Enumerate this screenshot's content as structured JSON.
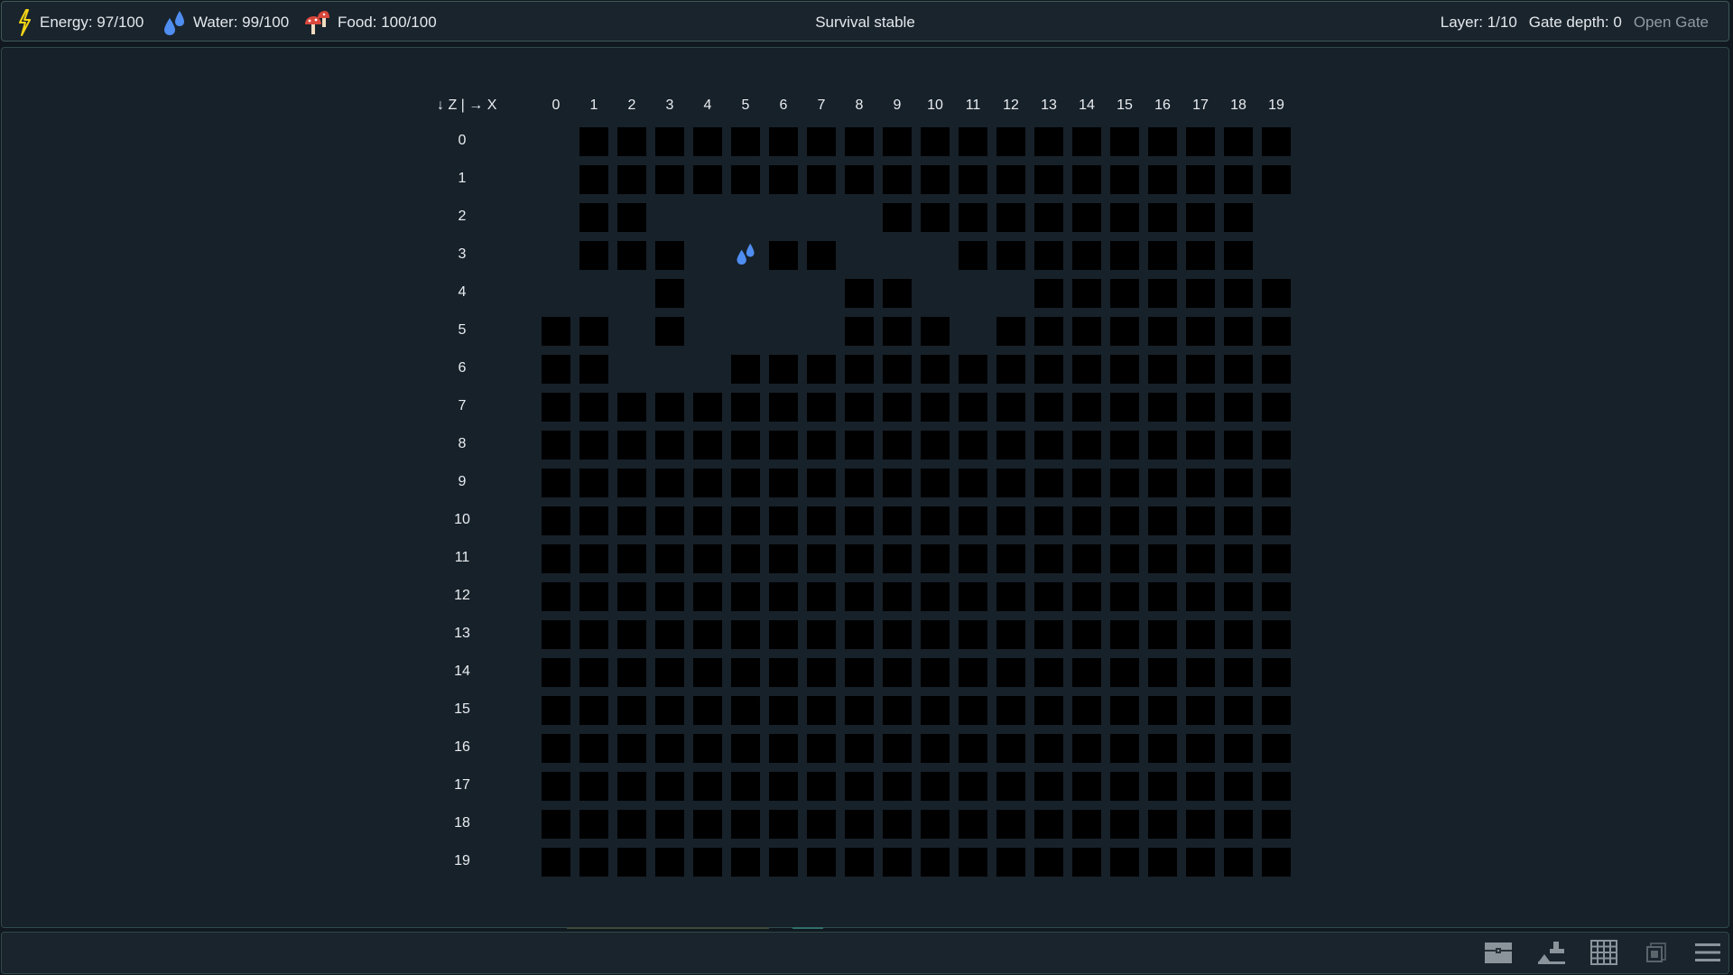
{
  "topbar": {
    "energy": {
      "label": "Energy: 97/100",
      "icon": "lightning-icon",
      "value": 97,
      "max": 100,
      "color": "#f5d515"
    },
    "water": {
      "label": "Water: 99/100",
      "icon": "water-drops-icon",
      "value": 99,
      "max": 100,
      "color": "#4f8df0"
    },
    "food": {
      "label": "Food: 100/100",
      "icon": "mushroom-icon",
      "value": 100,
      "max": 100,
      "color": "#d9473b"
    },
    "status": "Survival stable",
    "layer": "Layer: 1/10",
    "gate_depth": "Gate depth: 0",
    "open_gate": "Open Gate"
  },
  "grid": {
    "corner_label": "↓ Z | → X",
    "columns": [
      "0",
      "1",
      "2",
      "3",
      "4",
      "5",
      "6",
      "7",
      "8",
      "9",
      "10",
      "11",
      "12",
      "13",
      "14",
      "15",
      "16",
      "17",
      "18",
      "19"
    ],
    "rows": [
      "0",
      "1",
      "2",
      "3",
      "4",
      "5",
      "6",
      "7",
      "8",
      "9",
      "10",
      "11",
      "12",
      "13",
      "14",
      "15",
      "16",
      "17",
      "18",
      "19"
    ],
    "tiles": [
      ".###################",
      ".###################",
      ".##......##########.",
      ".###..##...########",
      "...#....##...#######",
      "##.#....###.########",
      "##...###############",
      "####################",
      "####################",
      "####################",
      "####################",
      "####################",
      "####################",
      "####################",
      "####################",
      "####################",
      "####################",
      "####################",
      "####################",
      "####################"
    ],
    "legend": {
      "#": "rock",
      ".": "open",
      "W": "water"
    },
    "water_source": {
      "x": 5,
      "z": 3,
      "icon": "water-drops-icon"
    }
  },
  "bottombar": {
    "buttons": [
      {
        "name": "chest-button",
        "icon": "chest-icon"
      },
      {
        "name": "build-button",
        "icon": "anvil-icon"
      },
      {
        "name": "grid-button",
        "icon": "grid-icon"
      },
      {
        "name": "layers-button",
        "icon": "cards-icon"
      },
      {
        "name": "menu-button",
        "icon": "menu-icon"
      }
    ]
  },
  "colors": {
    "background": "#111820",
    "panel": "#1a242d",
    "border": "#3d5a55",
    "rock": "#000000"
  }
}
